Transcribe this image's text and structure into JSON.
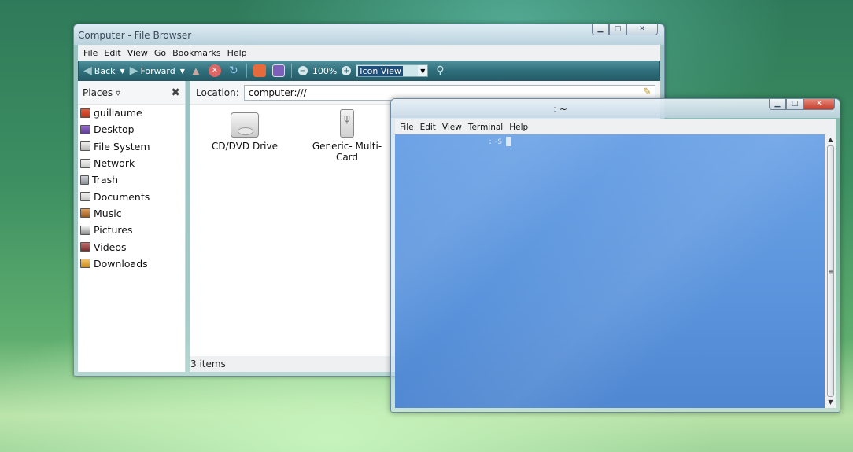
{
  "file_browser": {
    "title": "Computer - File Browser",
    "menu": [
      "File",
      "Edit",
      "View",
      "Go",
      "Bookmarks",
      "Help"
    ],
    "toolbar": {
      "back_label": "Back",
      "forward_label": "Forward",
      "zoom": "100%",
      "view_mode": "Icon View"
    },
    "sidebar": {
      "header": "Places",
      "items": [
        {
          "label": "guillaume",
          "icon": "home-icon"
        },
        {
          "label": "Desktop",
          "icon": "desktop-icon"
        },
        {
          "label": "File System",
          "icon": "filesystem-icon"
        },
        {
          "label": "Network",
          "icon": "network-icon"
        },
        {
          "label": "Trash",
          "icon": "trash-icon"
        },
        {
          "label": "Documents",
          "icon": "folder-icon"
        },
        {
          "label": "Music",
          "icon": "music-folder-icon"
        },
        {
          "label": "Pictures",
          "icon": "pictures-folder-icon"
        },
        {
          "label": "Videos",
          "icon": "videos-folder-icon"
        },
        {
          "label": "Downloads",
          "icon": "downloads-folder-icon"
        }
      ]
    },
    "location": {
      "label": "Location:",
      "value": "computer:///"
    },
    "files": [
      {
        "label": "CD/DVD Drive",
        "icon": "optical-drive-icon"
      },
      {
        "label": "Generic- Multi-Card",
        "icon": "usb-drive-icon"
      }
    ],
    "status": "3 items"
  },
  "terminal": {
    "title": ": ~",
    "menu": [
      "File",
      "Edit",
      "View",
      "Terminal",
      "Help"
    ],
    "prompt": ":~$"
  }
}
